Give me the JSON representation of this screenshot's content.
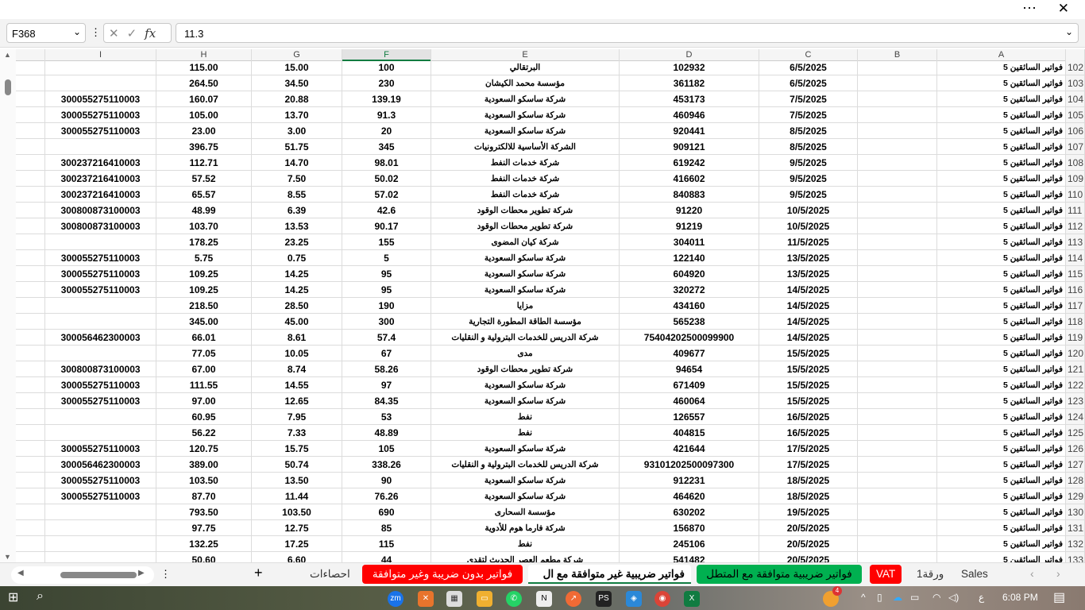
{
  "window": {
    "more_icon": "⋯",
    "close_icon": "✕"
  },
  "formula_bar": {
    "name_box": "F368",
    "cancel_icon": "✕",
    "enter_icon": "✓",
    "fx_label": "fx",
    "value": "11.3"
  },
  "columns": [
    "A",
    "B",
    "C",
    "D",
    "E",
    "F",
    "G",
    "H",
    "I"
  ],
  "selected_column": "F",
  "rows": [
    [
      "102",
      "فواتير السائقين 5",
      "",
      "6/5/2025",
      "102932",
      "البرتقالي",
      "100",
      "15.00",
      "115.00",
      ""
    ],
    [
      "103",
      "فواتير السائقين 5",
      "",
      "6/5/2025",
      "361182",
      "مؤسسة محمد الكيشان",
      "230",
      "34.50",
      "264.50",
      ""
    ],
    [
      "104",
      "فواتير السائقين 5",
      "",
      "7/5/2025",
      "453173",
      "شركة ساسكو السعودية",
      "139.19",
      "20.88",
      "160.07",
      "300055275110003"
    ],
    [
      "105",
      "فواتير السائقين 5",
      "",
      "7/5/2025",
      "460946",
      "شركة ساسكو السعودية",
      "91.3",
      "13.70",
      "105.00",
      "300055275110003"
    ],
    [
      "106",
      "فواتير السائقين 5",
      "",
      "8/5/2025",
      "920441",
      "شركة ساسكو السعودية",
      "20",
      "3.00",
      "23.00",
      "300055275110003"
    ],
    [
      "107",
      "فواتير السائقين 5",
      "",
      "8/5/2025",
      "909121",
      "الشركة الأساسية للالكترونيات",
      "345",
      "51.75",
      "396.75",
      ""
    ],
    [
      "108",
      "فواتير السائقين 5",
      "",
      "9/5/2025",
      "619242",
      "شركة خدمات النفط",
      "98.01",
      "14.70",
      "112.71",
      "300237216410003"
    ],
    [
      "109",
      "فواتير السائقين 5",
      "",
      "9/5/2025",
      "416602",
      "شركة خدمات النفط",
      "50.02",
      "7.50",
      "57.52",
      "300237216410003"
    ],
    [
      "110",
      "فواتير السائقين 5",
      "",
      "9/5/2025",
      "840883",
      "شركة خدمات النفط",
      "57.02",
      "8.55",
      "65.57",
      "300237216410003"
    ],
    [
      "111",
      "فواتير السائقين 5",
      "",
      "10/5/2025",
      "91220",
      "شركة تطوير محطات الوقود",
      "42.6",
      "6.39",
      "48.99",
      "300800873100003"
    ],
    [
      "112",
      "فواتير السائقين 5",
      "",
      "10/5/2025",
      "91219",
      "شركة تطوير محطات الوقود",
      "90.17",
      "13.53",
      "103.70",
      "300800873100003"
    ],
    [
      "113",
      "فواتير السائقين 5",
      "",
      "11/5/2025",
      "304011",
      "شركة كيان المضوى",
      "155",
      "23.25",
      "178.25",
      ""
    ],
    [
      "114",
      "فواتير السائقين 5",
      "",
      "13/5/2025",
      "122140",
      "شركة ساسكو السعودية",
      "5",
      "0.75",
      "5.75",
      "300055275110003"
    ],
    [
      "115",
      "فواتير السائقين 5",
      "",
      "13/5/2025",
      "604920",
      "شركة ساسكو السعودية",
      "95",
      "14.25",
      "109.25",
      "300055275110003"
    ],
    [
      "116",
      "فواتير السائقين 5",
      "",
      "14/5/2025",
      "320272",
      "شركة ساسكو السعودية",
      "95",
      "14.25",
      "109.25",
      "300055275110003"
    ],
    [
      "117",
      "فواتير السائقين 5",
      "",
      "14/5/2025",
      "434160",
      "مزايا",
      "190",
      "28.50",
      "218.50",
      ""
    ],
    [
      "118",
      "فواتير السائقين 5",
      "",
      "14/5/2025",
      "565238",
      "مؤسسة الطاقة المطورة التجارية",
      "300",
      "45.00",
      "345.00",
      ""
    ],
    [
      "119",
      "فواتير السائقين 5",
      "",
      "14/5/2025",
      "75404202500099900",
      "شركة الدريس للخدمات البترولية و النقليات",
      "57.4",
      "8.61",
      "66.01",
      "300056462300003"
    ],
    [
      "120",
      "فواتير السائقين 5",
      "",
      "15/5/2025",
      "409677",
      "مدى",
      "67",
      "10.05",
      "77.05",
      ""
    ],
    [
      "121",
      "فواتير السائقين 5",
      "",
      "15/5/2025",
      "94654",
      "شركة تطوير محطات الوقود",
      "58.26",
      "8.74",
      "67.00",
      "300800873100003"
    ],
    [
      "122",
      "فواتير السائقين 5",
      "",
      "15/5/2025",
      "671409",
      "شركة ساسكو السعودية",
      "97",
      "14.55",
      "111.55",
      "300055275110003"
    ],
    [
      "123",
      "فواتير السائقين 5",
      "",
      "15/5/2025",
      "460064",
      "شركة ساسكو السعودية",
      "84.35",
      "12.65",
      "97.00",
      "300055275110003"
    ],
    [
      "124",
      "فواتير السائقين 5",
      "",
      "16/5/2025",
      "126557",
      "نفط",
      "53",
      "7.95",
      "60.95",
      ""
    ],
    [
      "125",
      "فواتير السائقين 5",
      "",
      "16/5/2025",
      "404815",
      "نفط",
      "48.89",
      "7.33",
      "56.22",
      ""
    ],
    [
      "126",
      "فواتير السائقين 5",
      "",
      "17/5/2025",
      "421644",
      "شركة ساسكو السعودية",
      "105",
      "15.75",
      "120.75",
      "300055275110003"
    ],
    [
      "127",
      "فواتير السائقين 5",
      "",
      "17/5/2025",
      "93101202500097300",
      "شركة الدريس للخدمات البترولية و النقليات",
      "338.26",
      "50.74",
      "389.00",
      "300056462300003"
    ],
    [
      "128",
      "فواتير السائقين 5",
      "",
      "18/5/2025",
      "912231",
      "شركة ساسكو السعودية",
      "90",
      "13.50",
      "103.50",
      "300055275110003"
    ],
    [
      "129",
      "فواتير السائقين 5",
      "",
      "18/5/2025",
      "464620",
      "شركة ساسكو السعودية",
      "76.26",
      "11.44",
      "87.70",
      "300055275110003"
    ],
    [
      "130",
      "فواتير السائقين 5",
      "",
      "19/5/2025",
      "630202",
      "مؤسسة السحارى",
      "690",
      "103.50",
      "793.50",
      ""
    ],
    [
      "131",
      "فواتير السائقين 5",
      "",
      "20/5/2025",
      "156870",
      "شركة فارما هوم للأدوية",
      "85",
      "12.75",
      "97.75",
      ""
    ],
    [
      "132",
      "فواتير السائقين 5",
      "",
      "20/5/2025",
      "245106",
      "نفط",
      "115",
      "17.25",
      "132.25",
      ""
    ],
    [
      "133",
      "فواتير السائقين 5",
      "",
      "20/5/2025",
      "541482",
      "شركة مطعم العصر الحديث لتقدي",
      "44",
      "6.60",
      "50.60",
      ""
    ]
  ],
  "sheet_tabs": [
    {
      "label": "Sales",
      "color": ""
    },
    {
      "label": "ورقة1",
      "color": ""
    },
    {
      "label": "VAT",
      "color": "#ff0000"
    },
    {
      "label": "فواتير ضريبية متوافقة مع المتطل",
      "color": "#00b050"
    },
    {
      "label": "فواتير ضريبية غير متوافقة مع ال",
      "color": "",
      "active": true
    },
    {
      "label": "فواتير بدون ضريبة وغير متوافقة",
      "color": "#ff0000"
    },
    {
      "label": "احصاءات",
      "color": ""
    }
  ],
  "add_sheet": "+",
  "taskbar": {
    "time": "6:08 PM",
    "lang": "ع",
    "notification_badge": "4"
  }
}
